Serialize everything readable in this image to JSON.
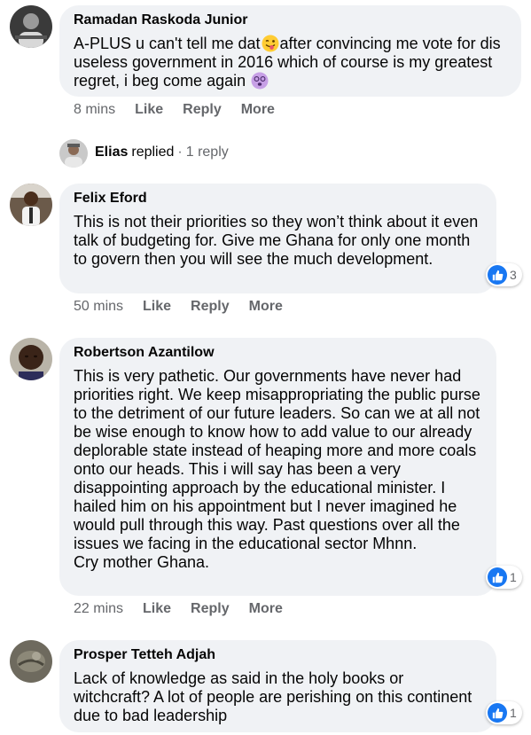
{
  "comments": [
    {
      "author": "Ramadan Raskoda Junior",
      "text_before_emoji": "A-PLUS u can't tell me dat",
      "emoji_1": "winking-tongue-emoji",
      "text_after_emoji": "after convincing me vote for dis useless government in 2016 which of course is my greatest regret, i beg come again",
      "emoji_2": "dizzy-face-emoji",
      "time": "8 mins",
      "like_label": "Like",
      "reply_label": "Reply",
      "more_label": "More"
    },
    {
      "author": "Felix Eford",
      "text": "This is not their priorities so they won’t think about it even talk of budgeting for. Give me Ghana for only one month to govern then you will see the much development.",
      "reaction_count": "3",
      "time": "50 mins",
      "like_label": "Like",
      "reply_label": "Reply",
      "more_label": "More"
    },
    {
      "author": "Robertson Azantilow",
      "text": "This is very pathetic. Our governments have never had priorities right. We keep misappropriating the public purse to the detriment of our future leaders. So can we at all not be wise enough to know how to add value to our already deplorable state instead of heaping more and more coals onto our heads. This i will say has been a very disappointing approach by the educational minister. I hailed him on his appointment but I never imagined he would pull through this way. Past questions over all the issues we facing in the educational sector Mhnn.\nCry mother Ghana.",
      "reaction_count": "1",
      "time": "22 mins",
      "like_label": "Like",
      "reply_label": "Reply",
      "more_label": "More"
    },
    {
      "author": "Prosper Tetteh Adjah",
      "text": "Lack of knowledge as said in the holy books or witchcraft? A lot of people are perishing on this continent due to bad leadership",
      "reaction_count": "1"
    }
  ],
  "reply_preview": {
    "name": "Elias",
    "verb": "replied",
    "separator": "·",
    "count": "1 reply"
  },
  "colors": {
    "bubble": "#f0f2f5",
    "meta_text": "#65676b",
    "like_blue": "#1877f2"
  },
  "icons": {
    "like": "thumbs-up-icon"
  }
}
